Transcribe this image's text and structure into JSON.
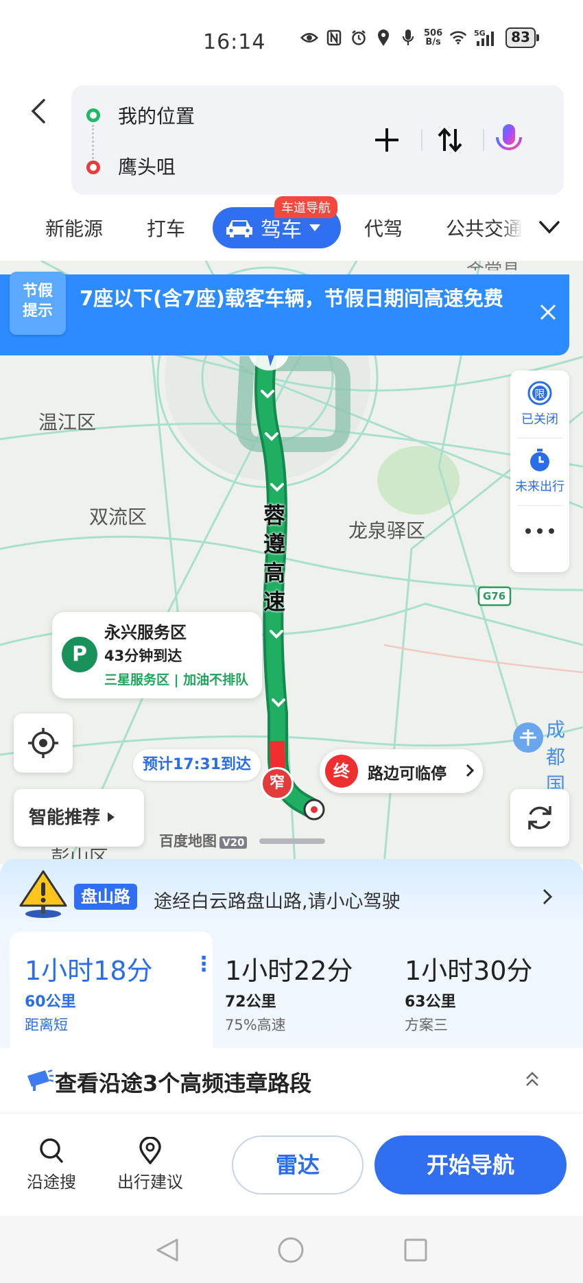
{
  "status_bar": {
    "time": "16:14",
    "net_speed_top": "506",
    "net_speed_bottom": "B/s",
    "battery": "83",
    "icons": [
      "eye-icon",
      "nfc-icon",
      "alarm-icon",
      "location-icon",
      "mic-icon",
      "wifi-icon",
      "signal-5g-icon"
    ]
  },
  "route": {
    "origin": "我的位置",
    "destination": "鹰头咀"
  },
  "modes": {
    "items": [
      "新能源",
      "打车",
      "驾车",
      "代驾",
      "公共交通"
    ],
    "active": "驾车",
    "badge": "车道导航"
  },
  "notice": {
    "tag_line1": "节假",
    "tag_line2": "提示",
    "text": "7座以下(含7座)载客车辆，节假日期间高速免费"
  },
  "map": {
    "labels": {
      "wenjiang": "温江区",
      "shuangliu": "双流区",
      "longquanyi": "龙泉驿区",
      "road": "蓉遵高速",
      "highway_code": "G76",
      "airport_line1": "成都",
      "airport_line2": "国际",
      "pengshan": "彭山区",
      "top_clip": "金堂县"
    },
    "tools": {
      "closed_label": "已关闭",
      "future_label": "未来出行",
      "limit_glyph": "限"
    },
    "service_area": {
      "name": "永兴服务区",
      "time": "43分钟到达",
      "sub": "三星服务区 | 加油不排队"
    },
    "eta": "预计17:31到达",
    "narrow": "窄",
    "end": {
      "glyph": "终",
      "text": "路边可临停"
    },
    "smart": "智能推荐",
    "watermark": "百度地图",
    "watermark_ver": "V20"
  },
  "sheet": {
    "warn_tag": "盘山路",
    "warn_text": "途经白云路盘山路,请小心驾驶",
    "routes": [
      {
        "time": "1小时18分",
        "distance": "60公里",
        "tag": "距离短"
      },
      {
        "time": "1小时22分",
        "distance": "72公里",
        "tag": "75%高速"
      },
      {
        "time": "1小时30分",
        "distance": "63公里",
        "tag": "方案三"
      }
    ],
    "violation": "查看沿途3个高频违章路段"
  },
  "actions": {
    "along_search": "沿途搜",
    "travel_advice": "出行建议",
    "radar": "雷达",
    "start": "开始导航"
  },
  "colors": {
    "accent": "#2f6ff0",
    "route_green": "#1fae62",
    "danger": "#ef2f2f"
  }
}
